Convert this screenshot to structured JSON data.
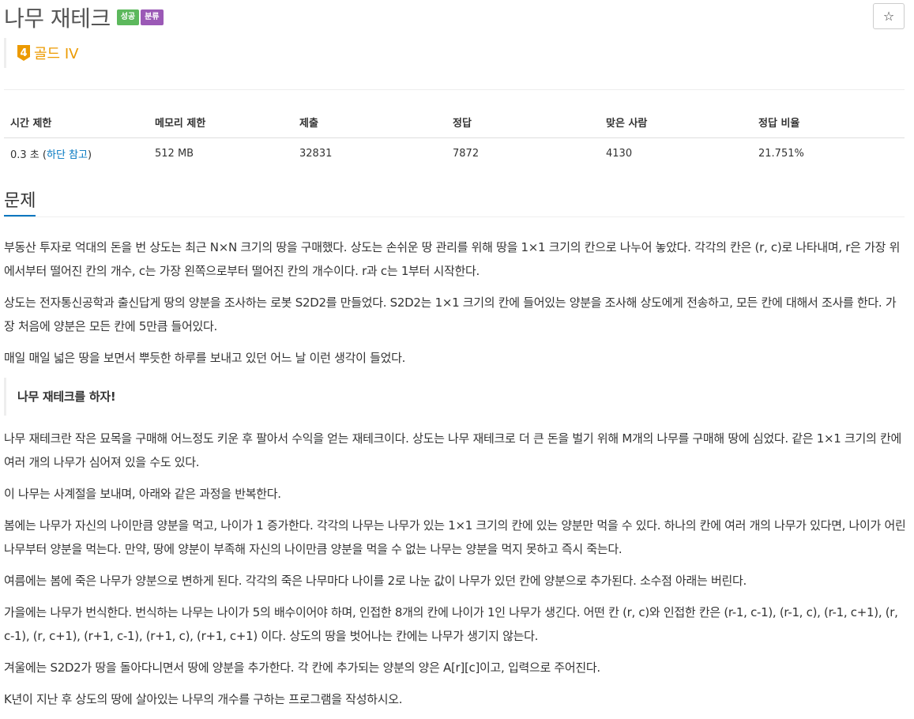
{
  "problem": {
    "title": "나무 재테크",
    "badges": [
      {
        "label": "성공",
        "color": "#5cb85c"
      },
      {
        "label": "분류",
        "color": "#9b59b6"
      }
    ],
    "tier": {
      "number": "4",
      "label": "골드 IV",
      "color": "#ec9a00"
    }
  },
  "star_icon": "☆",
  "stats": {
    "headers": [
      "시간 제한",
      "메모리 제한",
      "제출",
      "정답",
      "맞은 사람",
      "정답 비율"
    ],
    "time_value": "0.3 초 (",
    "time_link": "하단 참고",
    "time_close": ")",
    "memory": "512 MB",
    "submissions": "32831",
    "accepted": "7872",
    "solvers": "4130",
    "ratio": "21.751%"
  },
  "section_title": "문제",
  "paragraphs": [
    "부동산 투자로 억대의 돈을 번 상도는 최근 N×N 크기의 땅을 구매했다. 상도는 손쉬운 땅 관리를 위해 땅을 1×1 크기의 칸으로 나누어 놓았다. 각각의 칸은 (r, c)로 나타내며, r은 가장 위에서부터 떨어진 칸의 개수, c는 가장 왼쪽으로부터 떨어진 칸의 개수이다. r과 c는 1부터 시작한다.",
    "상도는 전자통신공학과 출신답게 땅의 양분을 조사하는 로봇 S2D2를 만들었다. S2D2는 1×1 크기의 칸에 들어있는 양분을 조사해 상도에게 전송하고, 모든 칸에 대해서 조사를 한다. 가장 처음에 양분은 모든 칸에 5만큼 들어있다.",
    "매일 매일 넓은 땅을 보면서 뿌듯한 하루를 보내고 있던 어느 날 이런 생각이 들었다."
  ],
  "quote": "나무 재테크를 하자!",
  "paragraphs2": [
    "나무 재테크란 작은 묘목을 구매해 어느정도 키운 후 팔아서 수익을 얻는 재테크이다. 상도는 나무 재테크로 더 큰 돈을 벌기 위해 M개의 나무를 구매해 땅에 심었다. 같은 1×1 크기의 칸에 여러 개의 나무가 심어져 있을 수도 있다.",
    "이 나무는 사계절을 보내며, 아래와 같은 과정을 반복한다.",
    "봄에는 나무가 자신의 나이만큼 양분을 먹고, 나이가 1 증가한다. 각각의 나무는 나무가 있는 1×1 크기의 칸에 있는 양분만 먹을 수 있다. 하나의 칸에 여러 개의 나무가 있다면, 나이가 어린 나무부터 양분을 먹는다. 만약, 땅에 양분이 부족해 자신의 나이만큼 양분을 먹을 수 없는 나무는 양분을 먹지 못하고 즉시 죽는다.",
    "여름에는 봄에 죽은 나무가 양분으로 변하게 된다. 각각의 죽은 나무마다 나이를 2로 나눈 값이 나무가 있던 칸에 양분으로 추가된다. 소수점 아래는 버린다.",
    "가을에는 나무가 번식한다. 번식하는 나무는 나이가 5의 배수이어야 하며, 인접한 8개의 칸에 나이가 1인 나무가 생긴다. 어떤 칸 (r, c)와 인접한 칸은 (r-1, c-1), (r-1, c), (r-1, c+1), (r, c-1), (r, c+1), (r+1, c-1), (r+1, c), (r+1, c+1) 이다. 상도의 땅을 벗어나는 칸에는 나무가 생기지 않는다.",
    "겨울에는 S2D2가 땅을 돌아다니면서 땅에 양분을 추가한다. 각 칸에 추가되는 양분의 양은 A[r][c]이고, 입력으로 주어진다.",
    "K년이 지난 후 상도의 땅에 살아있는 나무의 개수를 구하는 프로그램을 작성하시오."
  ]
}
